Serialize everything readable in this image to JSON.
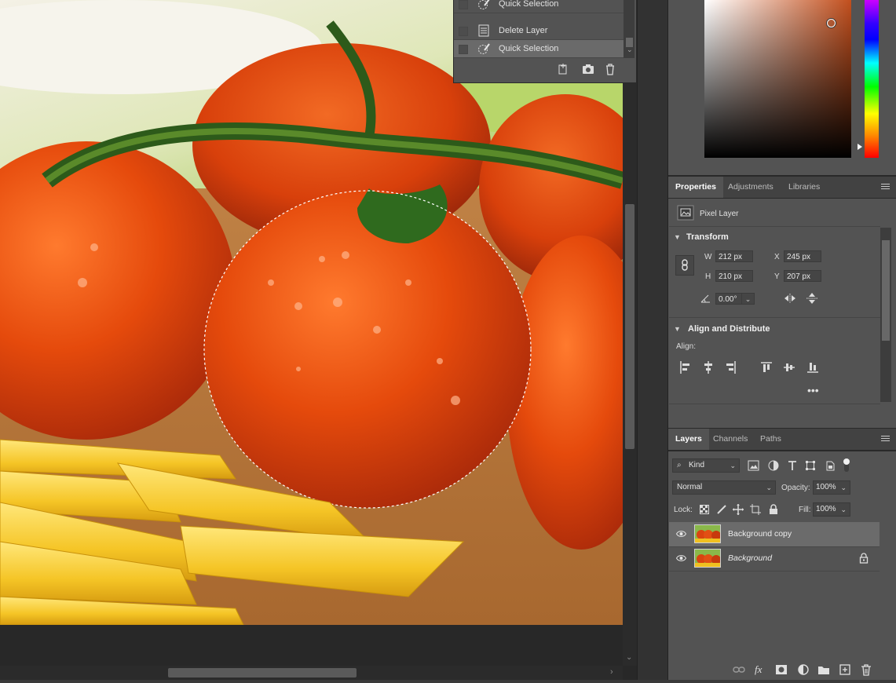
{
  "history": {
    "items": [
      {
        "label": "Quick Selection",
        "icon": "quick-selection-icon",
        "active": false
      },
      {
        "label": "Delete Layer",
        "icon": "history-state-icon",
        "active": false
      },
      {
        "label": "Quick Selection",
        "icon": "quick-selection-icon",
        "active": true
      }
    ]
  },
  "properties": {
    "tabs": [
      "Properties",
      "Adjustments",
      "Libraries"
    ],
    "layer_type": "Pixel Layer",
    "transform": {
      "title": "Transform",
      "w_label": "W",
      "w_value": "212 px",
      "h_label": "H",
      "h_value": "210 px",
      "x_label": "X",
      "x_value": "245 px",
      "y_label": "Y",
      "y_value": "207 px",
      "angle_value": "0.00°"
    },
    "align": {
      "title": "Align and Distribute",
      "label": "Align:"
    }
  },
  "layers": {
    "tabs": [
      "Layers",
      "Channels",
      "Paths"
    ],
    "filter_kind": "Kind",
    "blend_mode": "Normal",
    "opacity_label": "Opacity:",
    "opacity_value": "100%",
    "lock_label": "Lock:",
    "fill_label": "Fill:",
    "fill_value": "100%",
    "items": [
      {
        "name": "Background copy",
        "active": true,
        "locked": false
      },
      {
        "name": "Background",
        "active": false,
        "locked": true
      }
    ]
  },
  "colors": {
    "picker_base": "#c24f1d",
    "panel_bg": "#535353",
    "selected_row": "#6b6b6b"
  }
}
